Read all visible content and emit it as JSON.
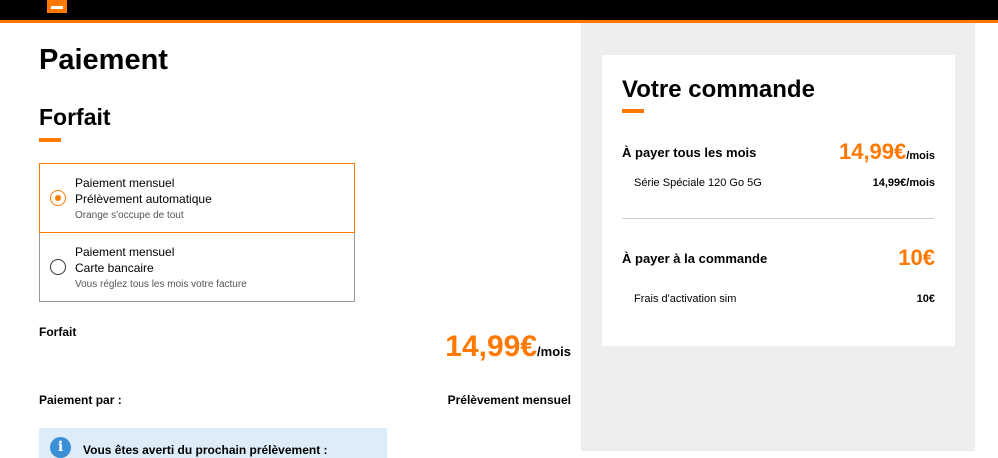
{
  "page": {
    "title": "Paiement"
  },
  "forfait_section": {
    "title": "Forfait"
  },
  "payment_options": [
    {
      "line1": "Paiement mensuel",
      "line2": "Prélèvement automatique",
      "line3": "Orange s'occupe de tout",
      "selected": true
    },
    {
      "line1": "Paiement mensuel",
      "line2": "Carte bancaire",
      "line3": "Vous réglez tous les mois votre facture",
      "selected": false
    }
  ],
  "summary": {
    "forfait_label": "Forfait",
    "forfait_price": "14,99€",
    "forfait_unit": "/mois",
    "payment_by_label": "Paiement par :",
    "payment_by_value": "Prélèvement mensuel"
  },
  "info_box": {
    "text": "Vous êtes averti du prochain prélèvement :"
  },
  "order": {
    "title": "Votre commande",
    "monthly": {
      "label": "À payer tous les mois",
      "price": "14,99€",
      "unit": "/mois",
      "item_name": "Série Spéciale 120 Go 5G",
      "item_price": "14,99€/mois"
    },
    "at_order": {
      "label": "À payer à la commande",
      "price": "10€",
      "item_name": "Frais d'activation sim",
      "item_price": "10€"
    }
  },
  "colors": {
    "accent": "#ff7900",
    "panel": "#eeeeee",
    "info_bg": "#dcecf8"
  }
}
